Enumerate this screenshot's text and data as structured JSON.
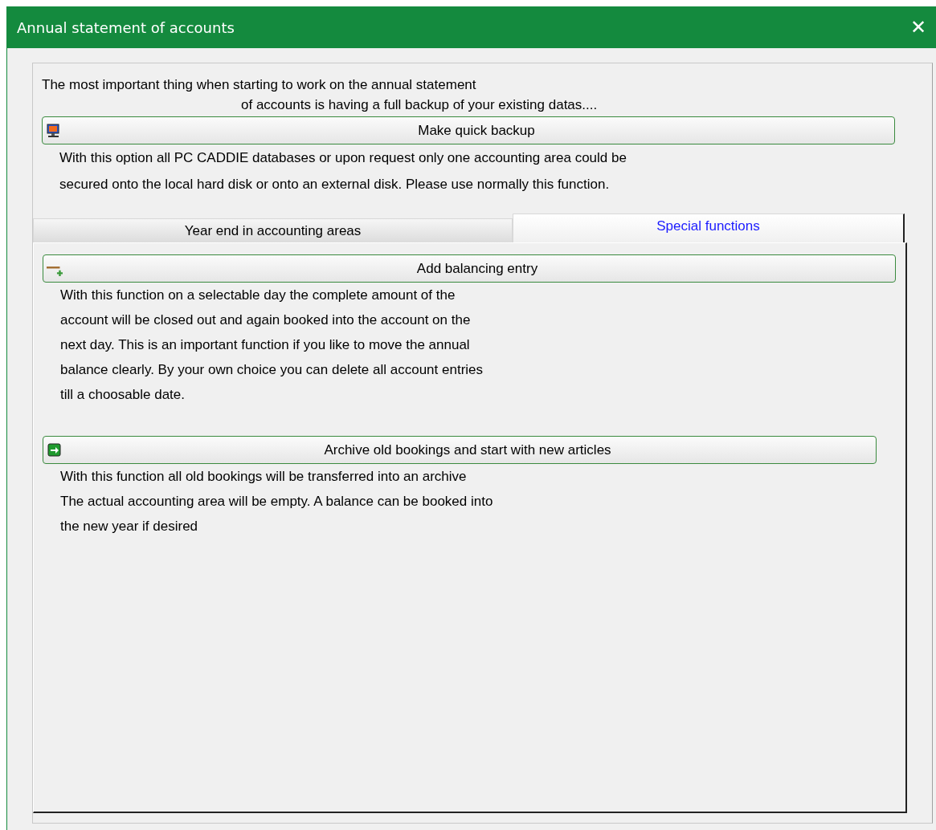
{
  "window": {
    "title": "Annual statement of accounts",
    "close": "✕"
  },
  "intro": [
    "The most important thing when starting to work on the annual statement",
    "of accounts is having a full backup of your existing datas...."
  ],
  "backup": {
    "label": "Make quick backup",
    "description": [
      "With this option all PC CADDIE databases or upon request only one accounting area could be",
      "secured onto the local hard disk or onto an external disk. Please use normally this function."
    ]
  },
  "tabs": [
    {
      "label": "Year end in accounting areas",
      "selected": false
    },
    {
      "label": "Special functions",
      "selected": true
    }
  ],
  "actions": [
    {
      "label": "Add balancing entry",
      "description": [
        "With this function on a selectable day the complete amount of the",
        "account will be closed out and again booked into the account on the",
        "next day. This is an important function if you like to move the annual",
        "balance clearly. By your own choice you can delete all account entries",
        "till a choosable date."
      ]
    },
    {
      "label": "Archive old bookings and start with new articles",
      "description": [
        "With this function all old bookings will be transferred into an archive",
        "The actual accounting area will be empty. A balance can be booked into",
        "the new year if desired"
      ]
    }
  ]
}
